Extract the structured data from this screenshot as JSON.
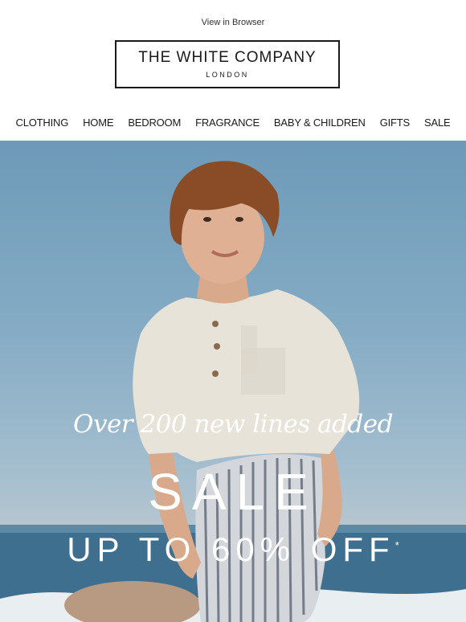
{
  "header": {
    "view_in_browser": "View in Browser",
    "logo": {
      "main": "THE WHITE COMPANY",
      "sub": "LONDON"
    }
  },
  "nav": {
    "items": [
      {
        "label": "CLOTHING"
      },
      {
        "label": "HOME"
      },
      {
        "label": "BEDROOM"
      },
      {
        "label": "FRAGRANCE"
      },
      {
        "label": "BABY & CHILDREN"
      },
      {
        "label": "GIFTS"
      },
      {
        "label": "SALE"
      }
    ]
  },
  "hero": {
    "tagline": "Over 200 new lines added",
    "headline": "SALE",
    "offer": "UP TO 60% OFF",
    "offer_mark": "*"
  },
  "colors": {
    "text": "#1a1a1a",
    "hero_sky": "#86acc5",
    "hero_text": "#ffffff"
  }
}
